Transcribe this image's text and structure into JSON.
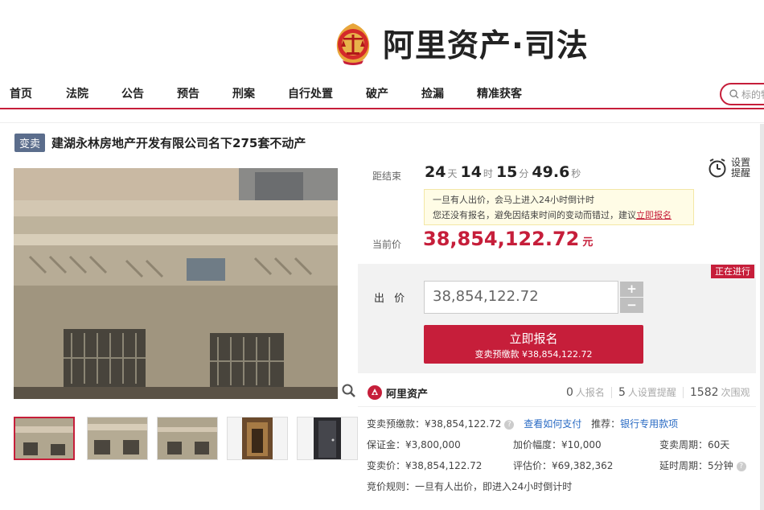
{
  "header": {
    "logo_text": "阿里资产·司法",
    "brand_color": "#c61e3a"
  },
  "nav": {
    "items": [
      "首页",
      "法院",
      "公告",
      "预告",
      "刑案",
      "自行处置",
      "破产",
      "捡漏",
      "精准获客"
    ],
    "search_placeholder": "标的物"
  },
  "item": {
    "tag": "变卖",
    "title": "建湖永林房地产开发有限公司名下275套不动产"
  },
  "gallery": {
    "thumb_count": 5,
    "active_index": 0
  },
  "countdown": {
    "label": "距结束",
    "days": "24",
    "days_unit": "天",
    "hours": "14",
    "hours_unit": "时",
    "minutes": "15",
    "minutes_unit": "分",
    "seconds": "49.6",
    "seconds_unit": "秒"
  },
  "remind": {
    "label_line1": "设置",
    "label_line2": "提醒"
  },
  "notice": {
    "line1": "一旦有人出价，会马上进入24小时倒计时",
    "line2_prefix": "您还没有报名，避免因结束时间的变动而错过，建议",
    "line2_link": "立即报名"
  },
  "price": {
    "label": "当前价",
    "value": "38,854,122.72",
    "unit": "元"
  },
  "bid": {
    "status": "正在进行",
    "label": "出 价",
    "input_value": "38,854,122.72",
    "plus": "+",
    "minus": "−",
    "register_label": "立即报名",
    "register_sub": "变卖预缴款 ¥38,854,122.72"
  },
  "ali": {
    "logo_text": "阿里资产"
  },
  "stats": {
    "registered": "0",
    "registered_unit": "人报名",
    "reminders": "5",
    "reminders_unit": "人设置提醒",
    "views": "1582",
    "views_unit": "次围观"
  },
  "info": {
    "deposit_label": "变卖预缴款：¥38,854,122.72",
    "how_to_pay": "查看如何支付",
    "recommend_label": "推荐：",
    "bank_account": "银行专用款项",
    "guarantee": "保证金：¥3,800,000",
    "increment": "加价幅度：¥10,000",
    "sale_period": "变卖周期：60天",
    "sale_price": "变卖价：¥38,854,122.72",
    "appraisal": "评估价：¥69,382,362",
    "delay_period": "延时周期：5分钟",
    "bid_rule": "竞价规则：一旦有人出价，即进入24小时倒计时"
  }
}
